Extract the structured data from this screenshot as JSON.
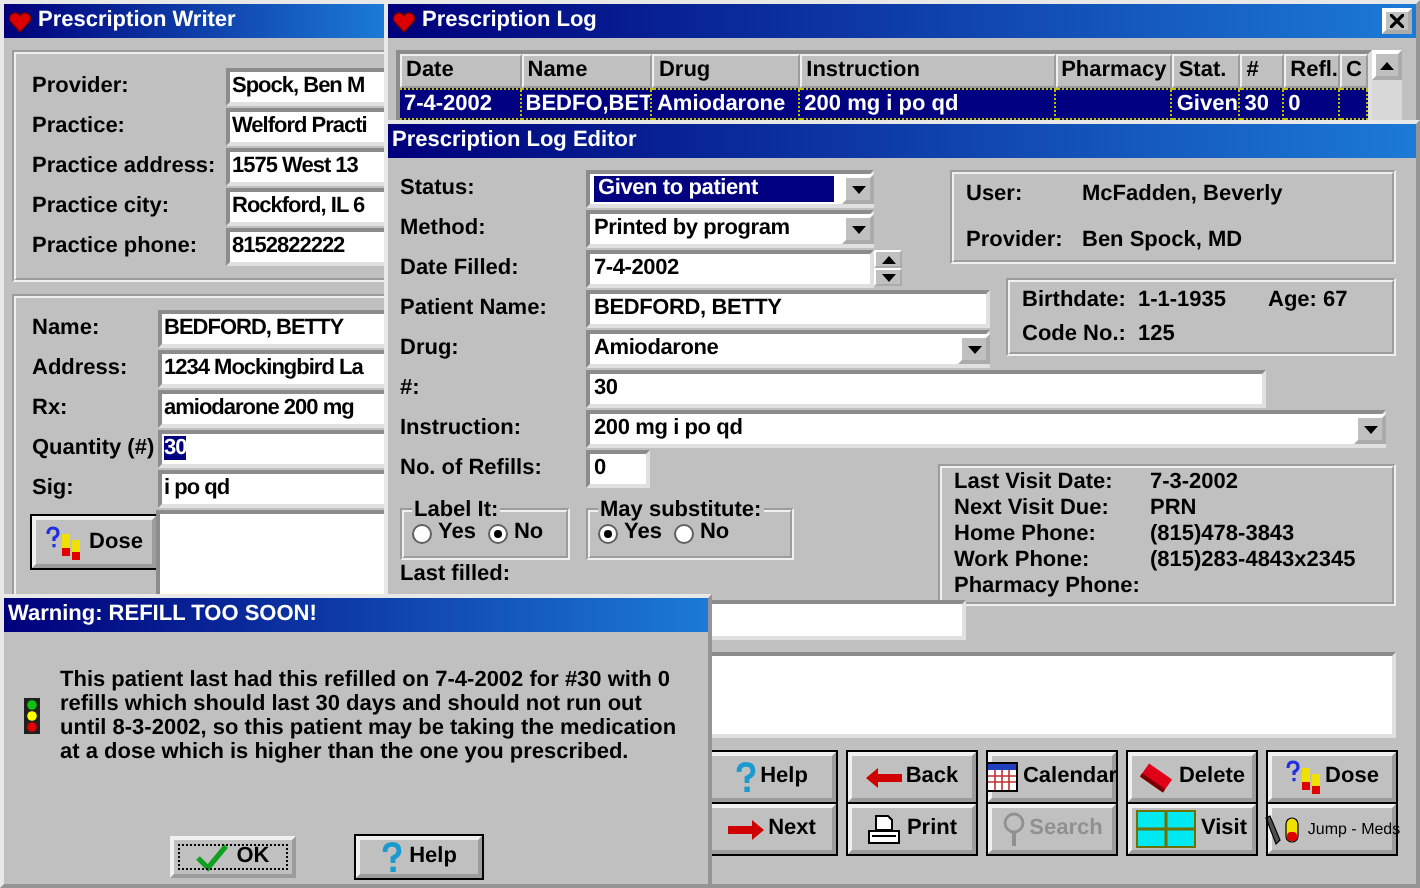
{
  "writer": {
    "title": "Prescription Writer",
    "practice_fields": [
      {
        "label": "Provider:",
        "value": "Spock, Ben M"
      },
      {
        "label": "Practice:",
        "value": "Welford Practi"
      },
      {
        "label": "Practice address:",
        "value": "1575 West 13"
      },
      {
        "label": "Practice city:",
        "value": "Rockford, IL 6"
      },
      {
        "label": "Practice phone:",
        "value": "8152822222"
      }
    ],
    "patient_fields": [
      {
        "label": "Name:",
        "value": "BEDFORD, BETTY",
        "selected": false
      },
      {
        "label": "Address:",
        "value": "1234 Mockingbird La",
        "selected": false
      },
      {
        "label": "Rx:",
        "value": "amiodarone 200 mg",
        "selected": false
      },
      {
        "label": "Quantity (#)",
        "value": "30",
        "selected": true
      },
      {
        "label": "Sig:",
        "value": "i po qd",
        "selected": false
      }
    ],
    "dose_button": "Dose"
  },
  "log": {
    "title": "Prescription Log",
    "columns": [
      "Date",
      "Name",
      "Drug",
      "Instruction",
      "Pharmacy",
      "Stat.",
      "#",
      "Refl.",
      "C"
    ],
    "rows": [
      {
        "selected": true,
        "cells": [
          "7-4-2002",
          "BEDFO,BET",
          "Amiodarone",
          "200 mg i po qd",
          null,
          "Given",
          "30",
          "0",
          null
        ]
      }
    ]
  },
  "editor": {
    "title": "Prescription Log Editor",
    "fields": [
      {
        "label": "Status:",
        "kind": "combo",
        "value": "Given to patient",
        "selected": true
      },
      {
        "label": "Method:",
        "kind": "combo",
        "value": "Printed by program",
        "selected": false
      },
      {
        "label": "Date Filled:",
        "kind": "spin",
        "value": "7-4-2002",
        "selected": false
      },
      {
        "label": "Patient Name:",
        "kind": "text",
        "value": "BEDFORD, BETTY",
        "selected": false
      },
      {
        "label": "Drug:",
        "kind": "combo",
        "value": "Amiodarone",
        "selected": false
      },
      {
        "label": "#:",
        "kind": "text",
        "value": "30",
        "selected": false
      },
      {
        "label": "Instruction:",
        "kind": "combo",
        "value": "200 mg i po qd",
        "selected": false
      },
      {
        "label": "No. of Refills:",
        "kind": "text",
        "value": "0",
        "selected": false
      }
    ],
    "user_panel": [
      {
        "label": "User:",
        "value": "McFadden, Beverly"
      },
      {
        "label": "Provider:",
        "value": "Ben Spock, MD"
      }
    ],
    "patient_panel": {
      "birthdate_label": "Birthdate:",
      "birthdate": "1-1-1935",
      "age": "Age: 67",
      "code_label": "Code No.:",
      "code": "125"
    },
    "visit_panel": [
      {
        "label": "Last Visit Date:",
        "value": "7-3-2002"
      },
      {
        "label": "Next Visit Due:",
        "value": "PRN"
      },
      {
        "label": "Home Phone:",
        "value": "(815)478-3843"
      },
      {
        "label": "Work Phone:",
        "value": "(815)283-4843x2345"
      },
      {
        "label": "Pharmacy Phone:"
      }
    ],
    "radio_groups": [
      {
        "title": "Label It:",
        "options": [
          {
            "label": "Yes",
            "selected": false
          },
          {
            "label": "No",
            "selected": true
          }
        ]
      },
      {
        "title": "May substitute:",
        "options": [
          {
            "label": "Yes",
            "selected": true
          },
          {
            "label": "No",
            "selected": false
          }
        ]
      }
    ],
    "last_filled_label": "Last filled:",
    "buttons": [
      {
        "label": "Help",
        "disabled": false
      },
      {
        "label": "Back",
        "disabled": false
      },
      {
        "label": "Calendar",
        "disabled": false
      },
      {
        "label": "Delete",
        "disabled": false
      },
      {
        "label": "Dose",
        "disabled": false
      },
      {
        "label": "Next",
        "disabled": false
      },
      {
        "label": "Print",
        "disabled": false
      },
      {
        "label": "Search",
        "disabled": true
      },
      {
        "label": "Visit",
        "disabled": false
      },
      {
        "label": "Jump - Meds",
        "disabled": false
      }
    ]
  },
  "warning": {
    "title": "Warning: REFILL TOO SOON!",
    "message": "This patient last had this refilled on 7-4-2002 for #30 with 0 refills which should last 30 days and should not run out until 8-3-2002, so this patient may be taking the medication at a dose which is higher than the one you prescribed.",
    "buttons": [
      "OK",
      "Help"
    ]
  }
}
